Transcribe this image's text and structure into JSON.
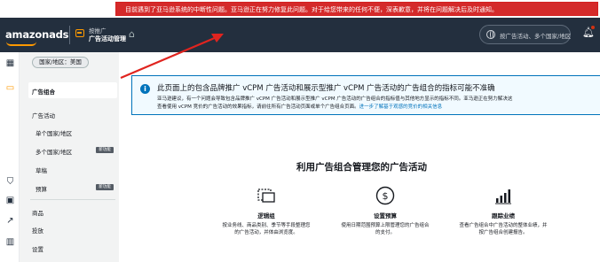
{
  "alert": {
    "text": "目前遇到了亚马逊系统的中断性问题。亚马逊正在努力修复此问题。对于给您带来的任何不便，深表歉意，并将在问题解决后及时通知。"
  },
  "topnav": {
    "logo": "amazonads",
    "section": "按推广",
    "page": "广告活动管理",
    "account": "按广告活动、多个国家/地区"
  },
  "sidebar": {
    "country": "国家/地区：美国",
    "portfolio": "广告组合",
    "campaigns_heading": "广告活动",
    "single_country": "单个国家/地区",
    "multi_country": "多个国家/地区",
    "multi_country_badge": "新功能",
    "drafts": "草稿",
    "budgets": "预算",
    "budgets_badge": "新功能",
    "products": "商品",
    "placements": "投放",
    "settings": "设置"
  },
  "info": {
    "icon_symbol": "i",
    "title": "此页面上的包含品牌推广 vCPM 广告活动和展示型推广 vCPM 广告活动的广告组合的指标可能不准确",
    "body_line1": "亚马逊建议，有一个问题会导致包含品牌推广 vCPM 广告活动和展示型推广 vCPM 广告活动的广告组合的指标值与其他地方显示的指标不同。亚马逊正在努力解决这",
    "body_line2": "查看使用 vCPM 竞价的广告活动的效果指标，请前往所有广告活动页面或单个广告组合页面。",
    "body_link": "进一步了解基于观感的竞价的相关信息"
  },
  "hero": {
    "title": "利用广告组合管理您的广告活动"
  },
  "features": [
    {
      "icon": "group-icon",
      "title": "逻辑组",
      "desc": "按业务线、商品类别、季节等手段整理您的广告活动，并体由浏览度。"
    },
    {
      "icon": "budget-icon",
      "title": "设置预算",
      "desc": "使用日期范围预算上限管理您的广告组合的支付。"
    },
    {
      "icon": "chart-icon",
      "title": "跟踪业绩",
      "desc": "查看广告组合中广告活动的整体业绩，并按广告组合创建报告。"
    }
  ],
  "colors": {
    "alert_red": "#d42a2a",
    "nav_dark": "#232f3e",
    "brand_orange": "#ff9900",
    "info_blue": "#0073bb"
  }
}
